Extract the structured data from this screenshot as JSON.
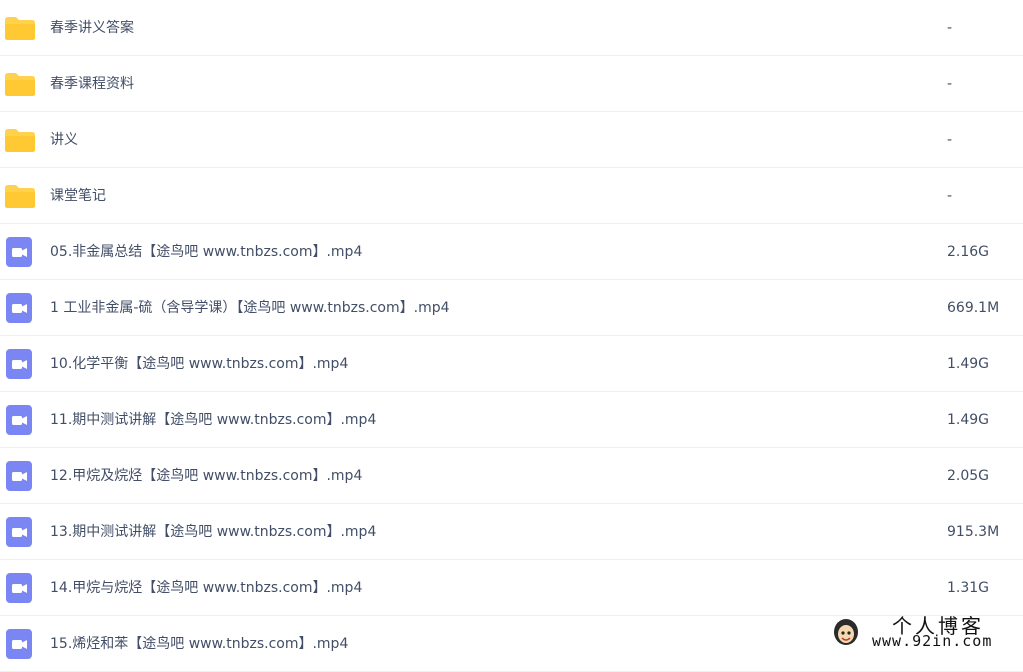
{
  "files": [
    {
      "name": "春季讲义答案",
      "size": "-",
      "type": "folder"
    },
    {
      "name": "春季课程资料",
      "size": "-",
      "type": "folder"
    },
    {
      "name": "讲义",
      "size": "-",
      "type": "folder"
    },
    {
      "name": "课堂笔记",
      "size": "-",
      "type": "folder"
    },
    {
      "name": "05.非金属总结【途鸟吧 www.tnbzs.com】.mp4",
      "size": "2.16G",
      "type": "video"
    },
    {
      "name": "1 工业非金属-硫（含导学课）【途鸟吧 www.tnbzs.com】.mp4",
      "size": "669.1M",
      "type": "video"
    },
    {
      "name": "10.化学平衡【途鸟吧 www.tnbzs.com】.mp4",
      "size": "1.49G",
      "type": "video"
    },
    {
      "name": "11.期中测试讲解【途鸟吧 www.tnbzs.com】.mp4",
      "size": "1.49G",
      "type": "video"
    },
    {
      "name": "12.甲烷及烷烃【途鸟吧 www.tnbzs.com】.mp4",
      "size": "2.05G",
      "type": "video"
    },
    {
      "name": "13.期中测试讲解【途鸟吧 www.tnbzs.com】.mp4",
      "size": "915.3M",
      "type": "video"
    },
    {
      "name": "14.甲烷与烷烃【途鸟吧 www.tnbzs.com】.mp4",
      "size": "1.31G",
      "type": "video"
    },
    {
      "name": "15.烯烃和苯【途鸟吧 www.tnbzs.com】.mp4",
      "size": "",
      "type": "video"
    }
  ],
  "watermark": {
    "title": "个人博客",
    "url": "www.92in.com"
  },
  "colors": {
    "folder": "#ffd24d",
    "video": "#7b86f5",
    "text": "#424e67",
    "divider": "#eef0f4"
  },
  "icons": {
    "folder": "folder-icon",
    "video": "video-file-icon"
  }
}
